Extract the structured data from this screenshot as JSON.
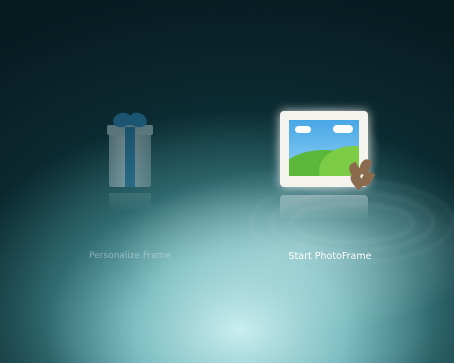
{
  "menu": {
    "items": [
      {
        "label": "Personalize Frame",
        "icon": "gift-icon",
        "state": "unselected"
      },
      {
        "label": "Start PhotoFrame",
        "icon": "photo-frame-icon",
        "state": "selected"
      }
    ]
  },
  "colors": {
    "background_dark": "#0d2f36",
    "background_light": "#c9eef0",
    "label": "#ffffff",
    "ribbon": "#2b7fb2"
  }
}
